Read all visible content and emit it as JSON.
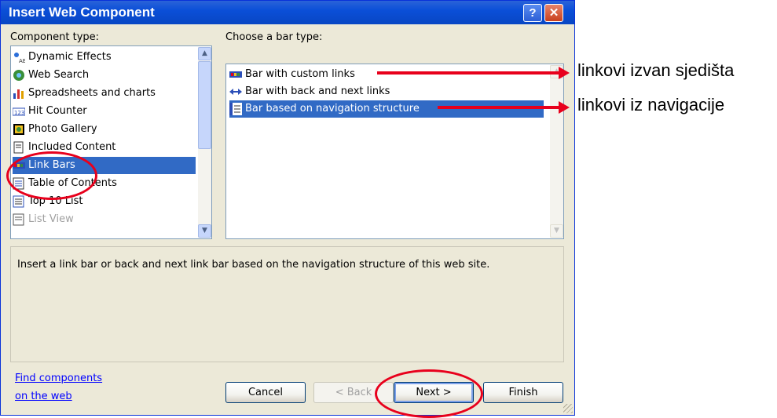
{
  "dialog": {
    "title": "Insert Web Component",
    "help_glyph": "?",
    "close_glyph": "✕"
  },
  "component_type": {
    "label": "Component type:",
    "items": [
      {
        "label": "Dynamic Effects",
        "icon": "dynamic-effects-icon"
      },
      {
        "label": "Web Search",
        "icon": "web-search-icon"
      },
      {
        "label": "Spreadsheets and charts",
        "icon": "spreadsheets-icon"
      },
      {
        "label": "Hit Counter",
        "icon": "hit-counter-icon"
      },
      {
        "label": "Photo Gallery",
        "icon": "photo-gallery-icon"
      },
      {
        "label": "Included Content",
        "icon": "included-content-icon"
      },
      {
        "label": "Link Bars",
        "icon": "link-bars-icon",
        "selected": true
      },
      {
        "label": "Table of Contents",
        "icon": "table-of-contents-icon"
      },
      {
        "label": "Top 10 List",
        "icon": "top-10-list-icon"
      },
      {
        "label": "List View",
        "icon": "list-view-icon",
        "disabled": true
      }
    ]
  },
  "bar_type": {
    "label": "Choose a bar type:",
    "items": [
      {
        "label": "Bar with custom links",
        "icon": "custom-links-icon"
      },
      {
        "label": "Bar with back and next links",
        "icon": "back-next-arrows-icon"
      },
      {
        "label": "Bar based on navigation structure",
        "icon": "navigation-structure-icon",
        "selected": true
      }
    ]
  },
  "description": "Insert a link bar or back and next link bar based on the navigation structure of this web site.",
  "find_link": {
    "line1": "Find components",
    "line2": "on the web"
  },
  "buttons": {
    "cancel": "Cancel",
    "back": "< Back",
    "next": "Next >",
    "finish": "Finish"
  },
  "annotations": {
    "custom_links_note": "linkovi izvan sjedišta",
    "navigation_note": "linkovi iz navigacije"
  },
  "colors": {
    "title_bar": "#0b4fd8",
    "selection": "#316ac5",
    "annotation_red": "#e8001c"
  }
}
